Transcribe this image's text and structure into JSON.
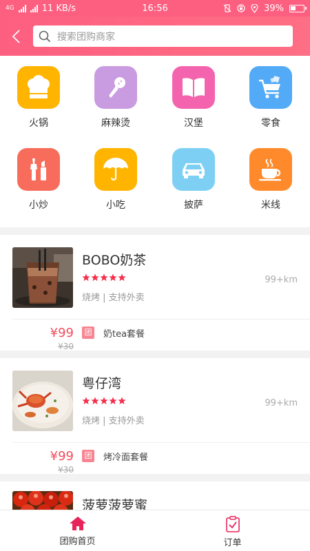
{
  "status_bar": {
    "network": "4G",
    "speed": "11 KB/s",
    "time": "16:56",
    "battery": "39%"
  },
  "header": {
    "search_placeholder": "搜索团购商家"
  },
  "categories": [
    {
      "label": "火锅",
      "icon": "chef-hat-icon",
      "color": "#ffb400"
    },
    {
      "label": "麻辣烫",
      "icon": "microphone-icon",
      "color": "#c99be0"
    },
    {
      "label": "汉堡",
      "icon": "book-icon",
      "color": "#f464ae"
    },
    {
      "label": "零食",
      "icon": "shopping-cart-icon",
      "color": "#53aaf6"
    },
    {
      "label": "小炒",
      "icon": "makeup-icon",
      "color": "#f76c5b"
    },
    {
      "label": "小吃",
      "icon": "umbrella-icon",
      "color": "#ffb400"
    },
    {
      "label": "披萨",
      "icon": "car-icon",
      "color": "#7dd0f4"
    },
    {
      "label": "米线",
      "icon": "coffee-cup-icon",
      "color": "#ff8a2b"
    }
  ],
  "stores": [
    {
      "name": "BOBO奶茶",
      "rating": 5,
      "tags": "烧烤 | 支持外卖",
      "distance": "99+km",
      "deal": {
        "price": "¥99",
        "original_price": "¥30",
        "badge": "团",
        "name": "奶tea套餐"
      }
    },
    {
      "name": "粤仔湾",
      "rating": 5,
      "tags": "烧烤 | 支持外卖",
      "distance": "99+km",
      "deal": {
        "price": "¥99",
        "original_price": "¥30",
        "badge": "团",
        "name": "烤冷面套餐"
      }
    },
    {
      "name": "菠萝菠萝蜜"
    }
  ],
  "tabbar": [
    {
      "label": "团购首页",
      "icon": "home-icon",
      "active": true
    },
    {
      "label": "订单",
      "icon": "clipboard-icon",
      "active": false
    }
  ],
  "colors": {
    "brand": "#fd5f80",
    "price": "#f44c5c",
    "star": "#f4304e"
  }
}
